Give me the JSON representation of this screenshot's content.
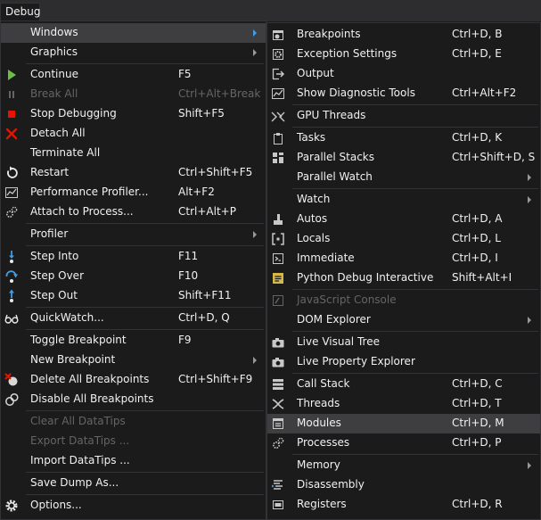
{
  "menubar": {
    "debug_label": "Debug"
  },
  "debug_menu": {
    "windows": "Windows",
    "graphics": "Graphics",
    "continue": "Continue",
    "continue_sc": "F5",
    "break_all": "Break All",
    "break_all_sc": "Ctrl+Alt+Break",
    "stop_debugging": "Stop Debugging",
    "stop_debugging_sc": "Shift+F5",
    "detach_all": "Detach All",
    "terminate_all": "Terminate All",
    "restart": "Restart",
    "restart_sc": "Ctrl+Shift+F5",
    "performance_profiler": "Performance Profiler...",
    "performance_profiler_sc": "Alt+F2",
    "attach_to_process": "Attach to Process...",
    "attach_to_process_sc": "Ctrl+Alt+P",
    "profiler": "Profiler",
    "step_into": "Step Into",
    "step_into_sc": "F11",
    "step_over": "Step Over",
    "step_over_sc": "F10",
    "step_out": "Step Out",
    "step_out_sc": "Shift+F11",
    "quickwatch": "QuickWatch...",
    "quickwatch_sc": "Ctrl+D, Q",
    "toggle_breakpoint": "Toggle Breakpoint",
    "toggle_breakpoint_sc": "F9",
    "new_breakpoint": "New Breakpoint",
    "delete_all_breakpoints": "Delete All Breakpoints",
    "delete_all_breakpoints_sc": "Ctrl+Shift+F9",
    "disable_all_breakpoints": "Disable All Breakpoints",
    "clear_all_datatips": "Clear All DataTips",
    "export_datatips": "Export DataTips ...",
    "import_datatips": "Import DataTips ...",
    "save_dump_as": "Save Dump As...",
    "options": "Options..."
  },
  "windows_menu": {
    "breakpoints": "Breakpoints",
    "breakpoints_sc": "Ctrl+D, B",
    "exception_settings": "Exception Settings",
    "exception_settings_sc": "Ctrl+D, E",
    "output": "Output",
    "show_diagnostic_tools": "Show Diagnostic Tools",
    "show_diagnostic_tools_sc": "Ctrl+Alt+F2",
    "gpu_threads": "GPU Threads",
    "tasks": "Tasks",
    "tasks_sc": "Ctrl+D, K",
    "parallel_stacks": "Parallel Stacks",
    "parallel_stacks_sc": "Ctrl+Shift+D, S",
    "parallel_watch": "Parallel Watch",
    "watch": "Watch",
    "autos": "Autos",
    "autos_sc": "Ctrl+D, A",
    "locals": "Locals",
    "locals_sc": "Ctrl+D, L",
    "immediate": "Immediate",
    "immediate_sc": "Ctrl+D, I",
    "python_debug_interactive": "Python Debug Interactive",
    "python_debug_interactive_sc": "Shift+Alt+I",
    "javascript_console": "JavaScript Console",
    "dom_explorer": "DOM Explorer",
    "live_visual_tree": "Live Visual Tree",
    "live_property_explorer": "Live Property Explorer",
    "call_stack": "Call Stack",
    "call_stack_sc": "Ctrl+D, C",
    "threads": "Threads",
    "threads_sc": "Ctrl+D, T",
    "modules": "Modules",
    "modules_sc": "Ctrl+D, M",
    "processes": "Processes",
    "processes_sc": "Ctrl+D, P",
    "memory": "Memory",
    "disassembly": "Disassembly",
    "registers": "Registers",
    "registers_sc": "Ctrl+D, R"
  },
  "colors": {
    "menu_background": "#1b1b1c",
    "hover_background": "#3e3e40",
    "text": "#f1f1f1",
    "disabled_text": "#656565",
    "accent_blue": "#3f9ee8",
    "play_green": "#6ebe46",
    "stop_red": "#e51400"
  },
  "icons": {
    "continue": "play-icon",
    "break_all": "pause-icon",
    "stop_debugging": "stop-icon",
    "detach_all": "detach-x-icon",
    "restart": "restart-icon",
    "step_into": "step-into-icon",
    "step_over": "step-over-icon",
    "step_out": "step-out-icon",
    "quickwatch": "glasses-icon",
    "options": "gear-icon"
  }
}
